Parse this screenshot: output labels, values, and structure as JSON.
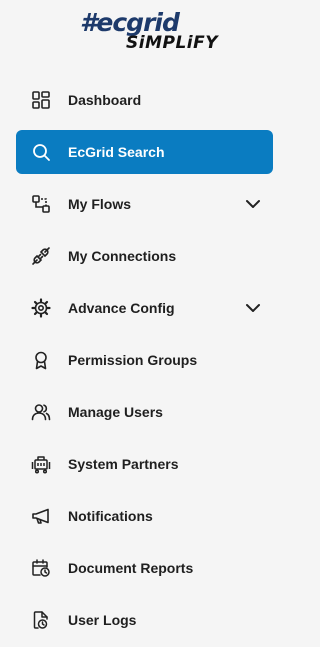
{
  "brand": {
    "line1": "#ecgrid",
    "line2": "SiMPLiFY"
  },
  "sidebar": {
    "items": [
      {
        "label": "Dashboard",
        "icon": "dashboard-grid-icon"
      },
      {
        "label": "EcGrid Search",
        "icon": "search-icon",
        "active": true
      },
      {
        "label": "My Flows",
        "icon": "flows-icon",
        "expandable": true
      },
      {
        "label": "My Connections",
        "icon": "connections-icon"
      },
      {
        "label": "Advance Config",
        "icon": "gear-icon",
        "expandable": true
      },
      {
        "label": "Permission Groups",
        "icon": "badge-icon"
      },
      {
        "label": "Manage Users",
        "icon": "users-icon"
      },
      {
        "label": "System Partners",
        "icon": "partners-icon"
      },
      {
        "label": "Notifications",
        "icon": "megaphone-icon"
      },
      {
        "label": "Document Reports",
        "icon": "calendar-clock-icon"
      },
      {
        "label": "User Logs",
        "icon": "file-clock-icon"
      }
    ]
  },
  "colors": {
    "active_bg": "#0a7cc1",
    "background": "#f5f5f5"
  }
}
